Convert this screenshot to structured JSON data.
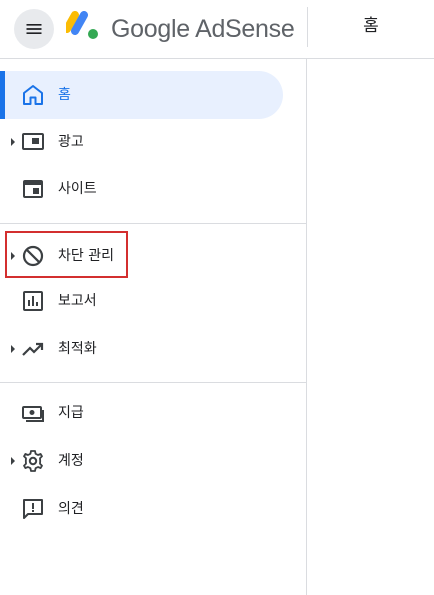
{
  "header": {
    "menu_icon": "hamburger-menu-icon",
    "logo_icon": "adsense-logo-icon",
    "brand_name": "Google AdSense",
    "page_title": "홈"
  },
  "sidebar": {
    "items": [
      {
        "label": "홈",
        "icon": "home-icon",
        "active": true,
        "expandable": false
      },
      {
        "label": "광고",
        "icon": "ads-icon",
        "active": false,
        "expandable": true
      },
      {
        "label": "사이트",
        "icon": "sites-icon",
        "active": false,
        "expandable": false
      },
      {
        "label": "차단 관리",
        "icon": "block-icon",
        "active": false,
        "expandable": true,
        "highlighted": true
      },
      {
        "label": "보고서",
        "icon": "reports-icon",
        "active": false,
        "expandable": false
      },
      {
        "label": "최적화",
        "icon": "trending-up-icon",
        "active": false,
        "expandable": true
      },
      {
        "label": "지급",
        "icon": "payments-icon",
        "active": false,
        "expandable": false
      },
      {
        "label": "계정",
        "icon": "settings-icon",
        "active": false,
        "expandable": true
      },
      {
        "label": "의견",
        "icon": "feedback-icon",
        "active": false,
        "expandable": false
      }
    ]
  },
  "colors": {
    "accent": "#1a73e8",
    "active_bg": "#e8f0fe",
    "highlight_border": "#d32f2f",
    "logo_yellow": "#fbbc04",
    "logo_blue": "#4285f4",
    "logo_green": "#34a853"
  }
}
